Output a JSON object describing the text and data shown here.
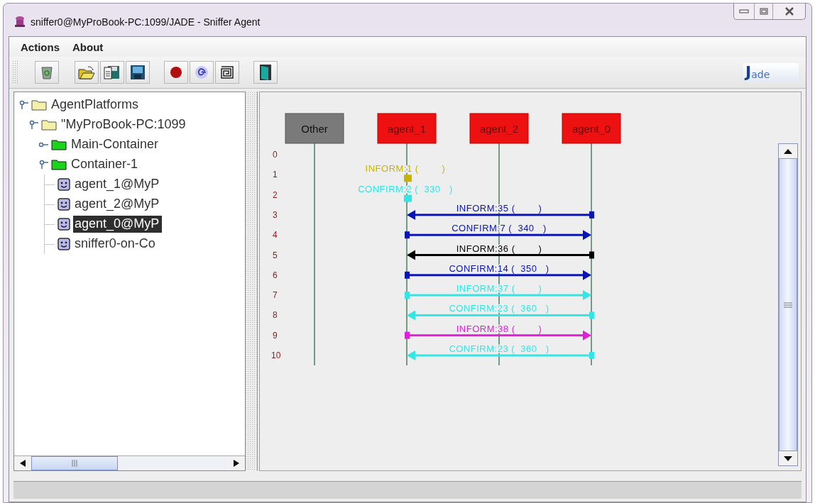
{
  "window": {
    "title": "sniffer0@MyProBook-PC:1099/JADE - Sniffer Agent"
  },
  "menu": [
    {
      "label": "Actions"
    },
    {
      "label": "About"
    }
  ],
  "logo": {
    "text": "Jade"
  },
  "tree": [
    {
      "label": "AgentPlatforms",
      "kind": "folder",
      "expanded": true,
      "selected": false,
      "children": [
        {
          "label": "\"MyProBook-PC:1099",
          "kind": "folder",
          "expanded": true,
          "selected": false,
          "children": [
            {
              "label": "Main-Container",
              "kind": "container",
              "expanded": false,
              "selected": false
            },
            {
              "label": "Container-1",
              "kind": "container",
              "expanded": true,
              "selected": false,
              "children": [
                {
                  "label": "agent_1@MyP",
                  "kind": "agent",
                  "selected": false
                },
                {
                  "label": "agent_2@MyP",
                  "kind": "agent",
                  "selected": false
                },
                {
                  "label": "agent_0@MyP",
                  "kind": "agent",
                  "selected": true
                },
                {
                  "label": "sniffer0-on-Co",
                  "kind": "agent",
                  "selected": false
                }
              ]
            }
          ]
        }
      ]
    }
  ],
  "diagram": {
    "agents": [
      {
        "name": "Other",
        "kind": "other"
      },
      {
        "name": "agent_1",
        "kind": "agent"
      },
      {
        "name": "agent_2",
        "kind": "agent"
      },
      {
        "name": "agent_0",
        "kind": "agent"
      }
    ],
    "rows": [
      {
        "number": "0"
      },
      {
        "number": "1",
        "message": {
          "kind": "stub",
          "label": "INFORM:1 (        )",
          "color": "#c8b400"
        }
      },
      {
        "number": "2",
        "message": {
          "kind": "stub",
          "label": "CONFIRM:2 (  330   )",
          "color": "#33e6e6"
        }
      },
      {
        "number": "3",
        "message": {
          "kind": "left",
          "label": "INFORM:35 (        )",
          "color": "#0a14b4"
        }
      },
      {
        "number": "4",
        "message": {
          "kind": "right",
          "label": "CONFIRM:7 (  340   )",
          "color": "#0a14b4"
        }
      },
      {
        "number": "5",
        "message": {
          "kind": "left",
          "label": "INFORM:36 (        )",
          "color": "#000000"
        }
      },
      {
        "number": "6",
        "message": {
          "kind": "right",
          "label": "CONFIRM:14 (  350   )",
          "color": "#0a14b4"
        }
      },
      {
        "number": "7",
        "message": {
          "kind": "right",
          "label": "INFORM:37 (        )",
          "color": "#33e6e6"
        }
      },
      {
        "number": "8",
        "message": {
          "kind": "left",
          "label": "CONFIRM:23 (  360   )",
          "color": "#33e6e6"
        }
      },
      {
        "number": "9",
        "message": {
          "kind": "right",
          "label": "INFORM:38 (        )",
          "color": "#e020d8"
        }
      },
      {
        "number": "10",
        "message": {
          "kind": "left",
          "label": "CONFIRM:23 (  360   )",
          "color": "#33e6e6"
        }
      }
    ]
  }
}
